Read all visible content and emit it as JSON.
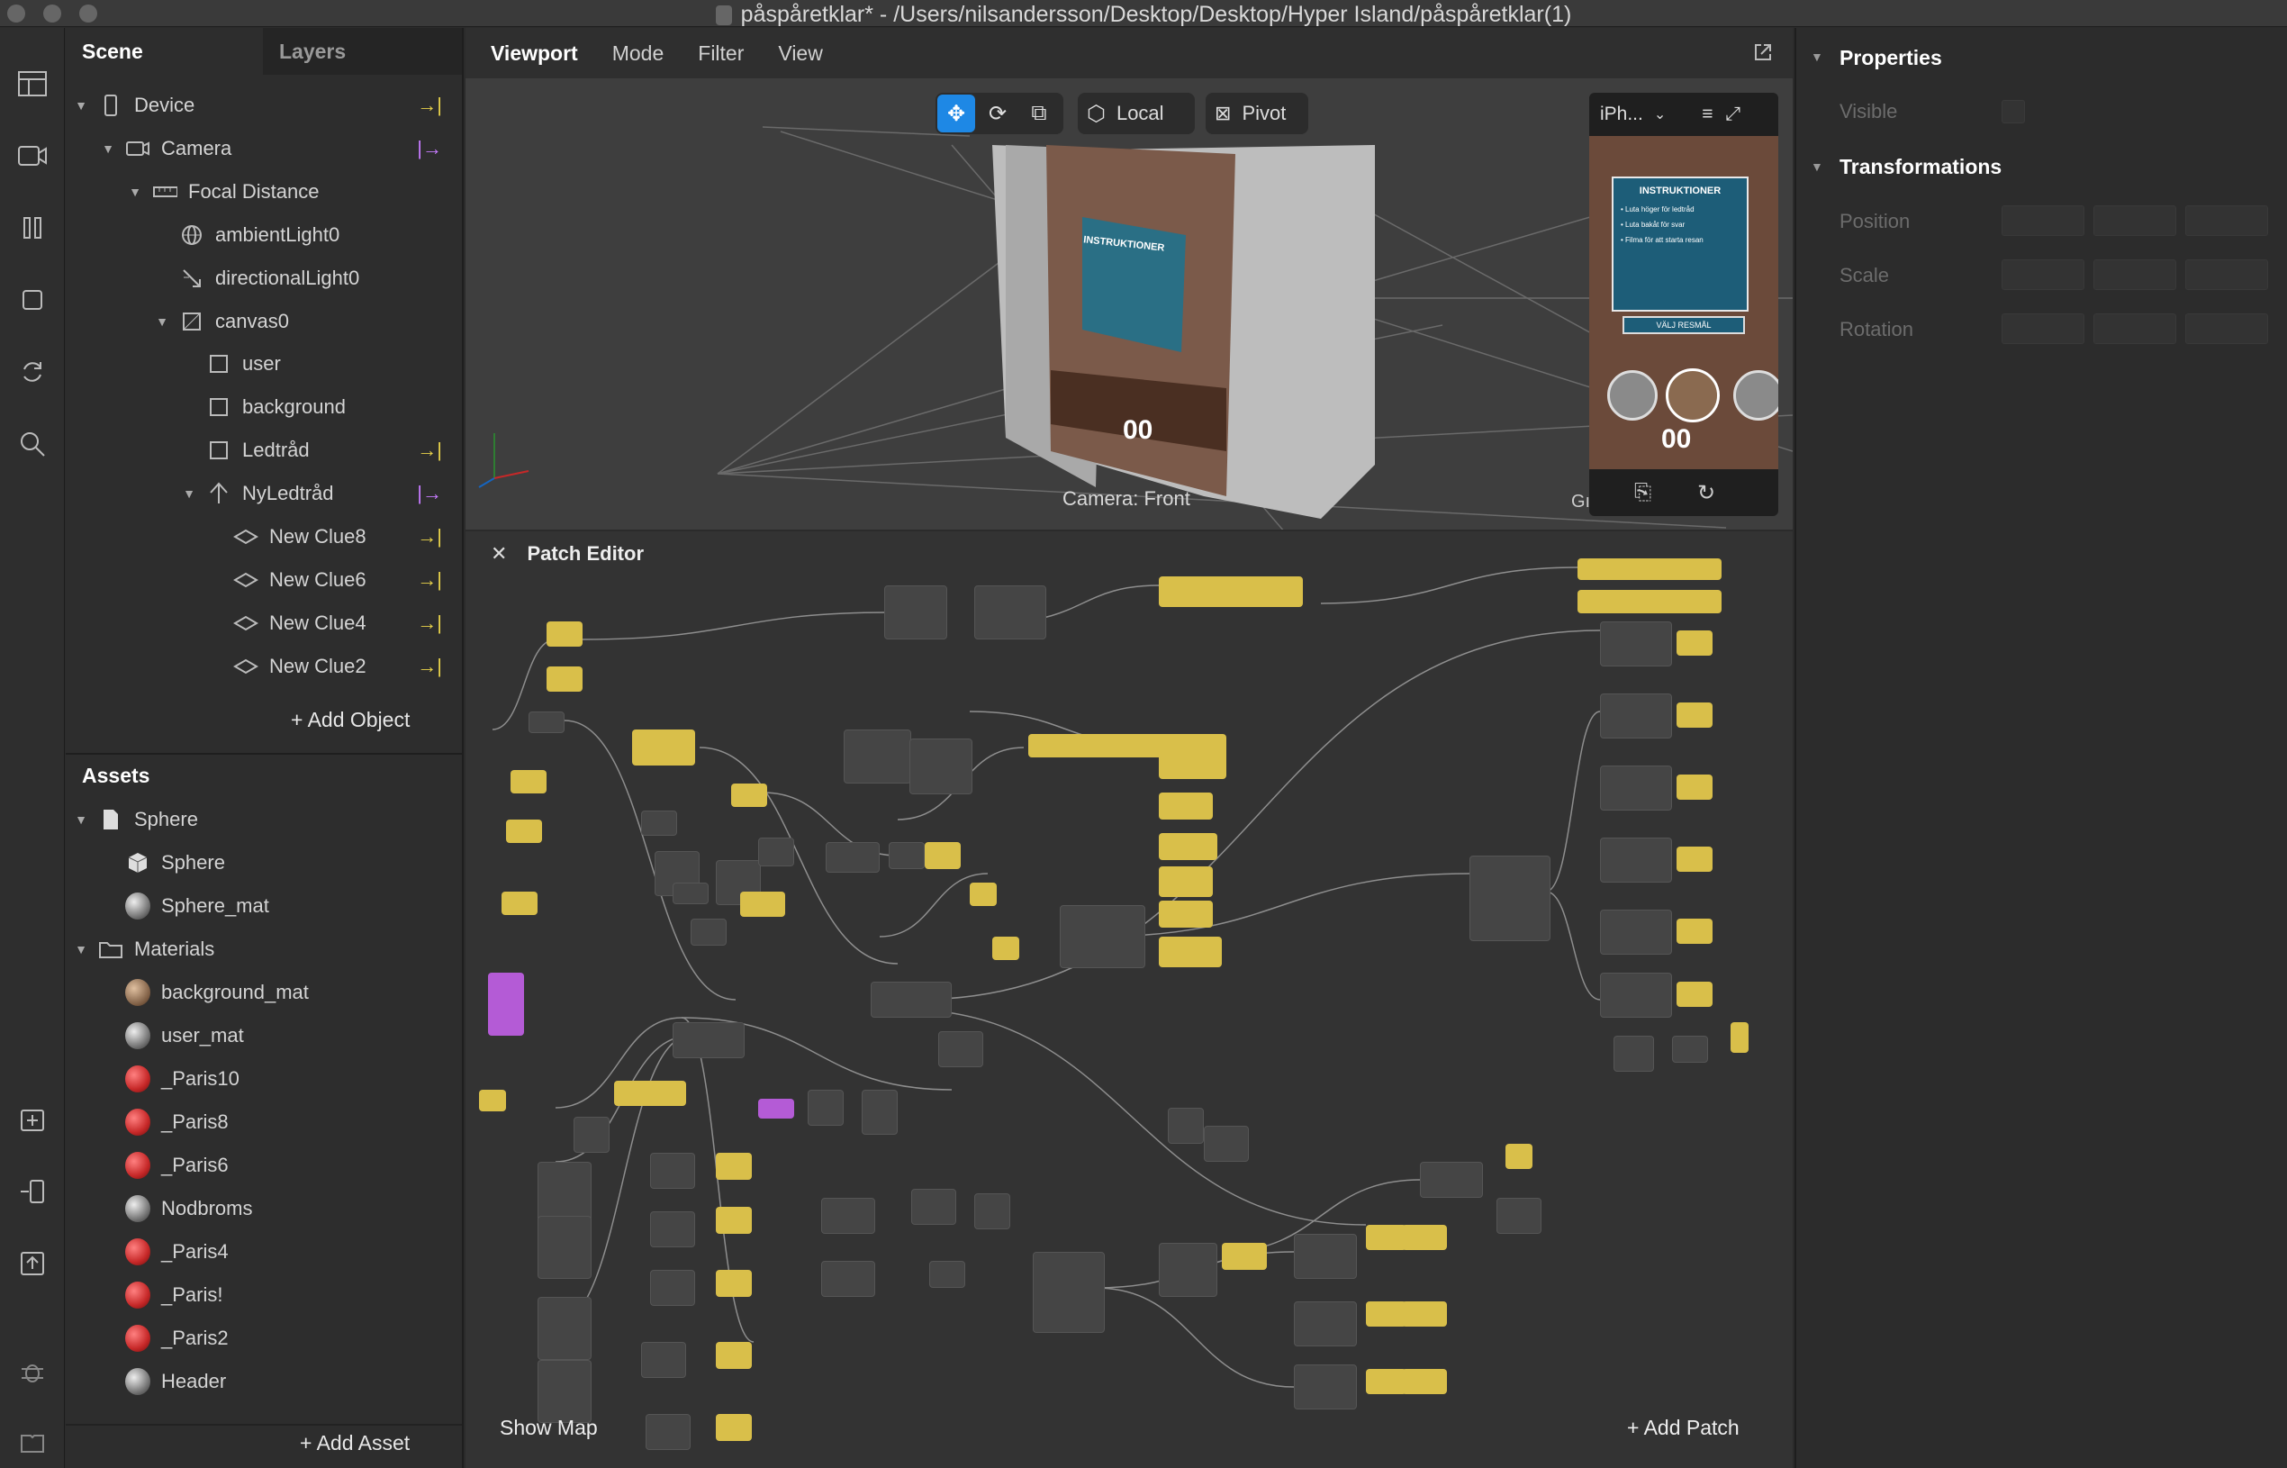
{
  "window": {
    "title": "påspåretklar* - /Users/nilsandersson/Desktop/Desktop/Hyper Island/påspåretklar(1)"
  },
  "scene": {
    "tabs": [
      "Scene",
      "Layers"
    ],
    "tree": [
      {
        "label": "Device",
        "icon": "device-icon",
        "indent": 0,
        "expand": true,
        "marker": "yellow"
      },
      {
        "label": "Camera",
        "icon": "camera-icon",
        "indent": 1,
        "expand": true,
        "marker": "purple"
      },
      {
        "label": "Focal Distance",
        "icon": "ruler-icon",
        "indent": 2,
        "expand": true
      },
      {
        "label": "ambientLight0",
        "icon": "globe-light-icon",
        "indent": 3
      },
      {
        "label": "directionalLight0",
        "icon": "directional-light-icon",
        "indent": 3
      },
      {
        "label": "canvas0",
        "icon": "canvas-icon",
        "indent": 3,
        "expand": true
      },
      {
        "label": "user",
        "icon": "rectangle-icon",
        "indent": 4
      },
      {
        "label": "background",
        "icon": "rectangle-icon",
        "indent": 4
      },
      {
        "label": "Ledtråd",
        "icon": "rectangle-icon",
        "indent": 4,
        "marker": "yellow"
      },
      {
        "label": "NyLedtråd",
        "icon": "null-object-icon",
        "indent": 4,
        "expand": true,
        "marker": "purple"
      },
      {
        "label": "New Clue8",
        "icon": "plane-icon",
        "indent": 5,
        "marker": "yellow"
      },
      {
        "label": "New Clue6",
        "icon": "plane-icon",
        "indent": 5,
        "marker": "yellow"
      },
      {
        "label": "New Clue4",
        "icon": "plane-icon",
        "indent": 5,
        "marker": "yellow"
      },
      {
        "label": "New Clue2",
        "icon": "plane-icon",
        "indent": 5,
        "marker": "yellow"
      }
    ],
    "add_object": "Add Object"
  },
  "assets": {
    "title": "Assets",
    "items": [
      {
        "label": "Sphere",
        "icon": "file-icon",
        "indent": 0,
        "expand": true
      },
      {
        "label": "Sphere",
        "icon": "cube-icon",
        "indent": 1
      },
      {
        "label": "Sphere_mat",
        "icon": "material-gray-icon",
        "indent": 1
      },
      {
        "label": "Materials",
        "icon": "folder-icon",
        "indent": 0,
        "expand": true
      },
      {
        "label": "background_mat",
        "icon": "material-brown-icon",
        "indent": 1
      },
      {
        "label": "user_mat",
        "icon": "material-gray-icon",
        "indent": 1
      },
      {
        "label": "_Paris10",
        "icon": "material-red-icon",
        "indent": 1
      },
      {
        "label": "_Paris8",
        "icon": "material-red-icon",
        "indent": 1
      },
      {
        "label": "_Paris6",
        "icon": "material-red-icon",
        "indent": 1
      },
      {
        "label": "Nodbroms",
        "icon": "material-gray-icon",
        "indent": 1
      },
      {
        "label": "_Paris4",
        "icon": "material-red-icon",
        "indent": 1
      },
      {
        "label": "_Paris!",
        "icon": "material-red-icon",
        "indent": 1
      },
      {
        "label": "_Paris2",
        "icon": "material-red-icon",
        "indent": 1
      },
      {
        "label": "Header",
        "icon": "material-gray-icon",
        "indent": 1
      }
    ],
    "add_asset": "Add Asset"
  },
  "viewport": {
    "menu": [
      "Viewport",
      "Mode",
      "Filter",
      "View"
    ],
    "local_label": "Local",
    "pivot_label": "Pivot",
    "camera_label": "Camera: Front",
    "device_label": "iPh...",
    "poster_title": "INSTRUKTIONER",
    "poster_lines": [
      "• Luta höger för ledtråd",
      "• Luta bakåt för svar",
      "• Filma för att starta resan"
    ],
    "poster_button": "VÄLJ RESMÅL",
    "phone_counter": "00",
    "g_label": "Gı"
  },
  "patch_editor": {
    "title": "Patch Editor",
    "show_map": "Show Map",
    "add_patch": "Add Patch"
  },
  "properties": {
    "title": "Properties",
    "visible_label": "Visible",
    "transform_title": "Transformations",
    "rows": [
      "Position",
      "Scale",
      "Rotation"
    ]
  },
  "colors": {
    "accent": "#1e88e5",
    "yellow_marker": "#e8d24a",
    "purple_marker": "#c77bff",
    "patch_yellow": "#d9bf4a",
    "patch_purple": "#b45bd6"
  }
}
